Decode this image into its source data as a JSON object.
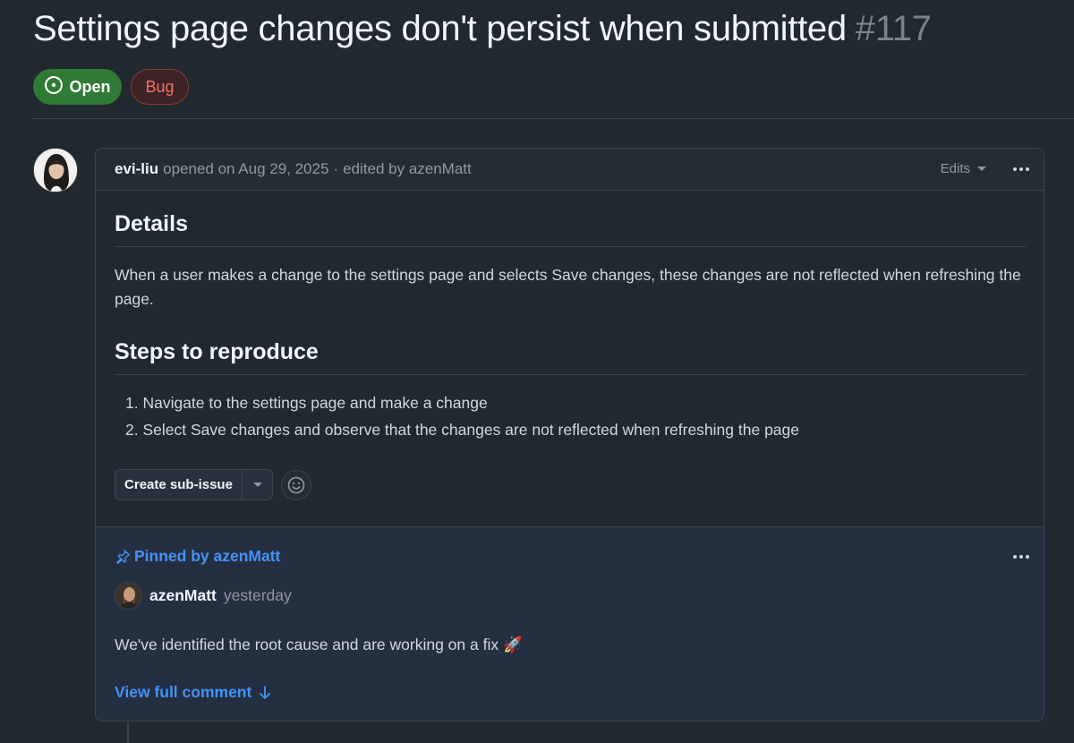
{
  "issue": {
    "title": "Settings page changes don't persist when submitted",
    "number": "#117",
    "state_label": "Open",
    "label": "Bug",
    "colors": {
      "open": "#2f7a34",
      "bug": "#f0745f",
      "link": "#4493f8"
    }
  },
  "comment": {
    "author": "evi-liu",
    "opened_text": "opened on Aug 29, 2025",
    "separator": "·",
    "edited_text": "edited by azenMatt",
    "edits_label": "Edits",
    "details_heading": "Details",
    "details_text": "When a user makes a change to the settings page and selects Save changes, these changes are not reflected when refreshing the page.",
    "steps_heading": "Steps to reproduce",
    "steps": [
      "1. Navigate to the settings page and make a change",
      "2. Select Save changes and observe that the changes are not reflected when refreshing the page"
    ],
    "create_sub_issue_label": "Create sub-issue"
  },
  "pinned": {
    "label": "Pinned by azenMatt",
    "author": "azenMatt",
    "time": "yesterday",
    "text": "We've identified the root cause and are working on a fix 🚀",
    "view_full_label": "View full comment"
  },
  "icons": {
    "state": "issue-open-icon",
    "menu": "kebab-horizontal-icon",
    "dropdown": "triangle-down-icon",
    "emoji": "smiley-icon",
    "pin": "pin-icon",
    "arrow": "arrow-down-icon"
  }
}
